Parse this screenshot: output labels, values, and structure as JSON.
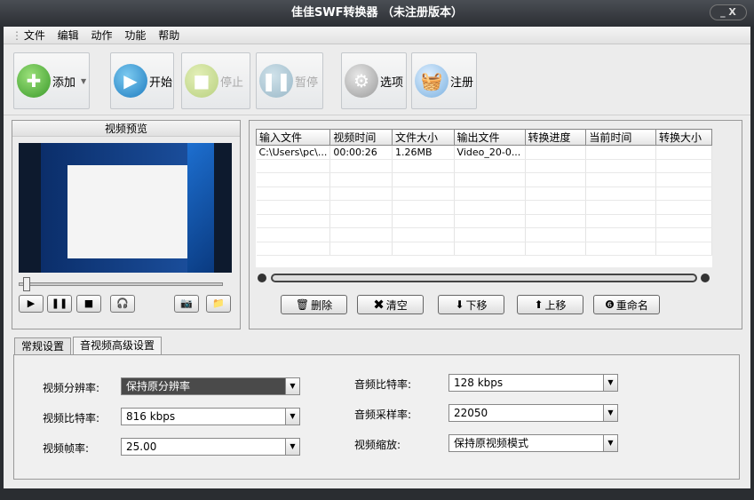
{
  "window": {
    "title": "佳佳SWF转换器  （未注册版本）",
    "controls": "_ X"
  },
  "menu": [
    "文件",
    "编辑",
    "动作",
    "功能",
    "帮助"
  ],
  "toolbar": {
    "add": "添加",
    "start": "开始",
    "stop": "停止",
    "pause": "暂停",
    "options": "选项",
    "register": "注册"
  },
  "preview": {
    "title": "视频预览"
  },
  "filelist": {
    "columns": [
      "输入文件",
      "视频时间",
      "文件大小",
      "输出文件",
      "转换进度",
      "当前时间",
      "转换大小"
    ],
    "rows": [
      [
        "C:\\Users\\pc\\...",
        "00:00:26",
        "1.26MB",
        "Video_20-0...",
        "",
        "",
        ""
      ]
    ]
  },
  "actions": {
    "delete": "删除",
    "clear": "清空",
    "down": "下移",
    "up": "上移",
    "rename": "重命名"
  },
  "tabs": [
    "常规设置",
    "音视频高级设置"
  ],
  "settings": {
    "video_resolution": {
      "label": "视频分辨率:",
      "value": "保持原分辨率"
    },
    "video_bitrate": {
      "label": "视频比特率:",
      "value": "816 kbps"
    },
    "video_fps": {
      "label": "视频帧率:",
      "value": "25.00"
    },
    "audio_bitrate": {
      "label": "音频比特率:",
      "value": "128 kbps"
    },
    "audio_samplerate": {
      "label": "音频采样率:",
      "value": "22050"
    },
    "video_scale": {
      "label": "视频缩放:",
      "value": "保持原视频模式"
    }
  }
}
